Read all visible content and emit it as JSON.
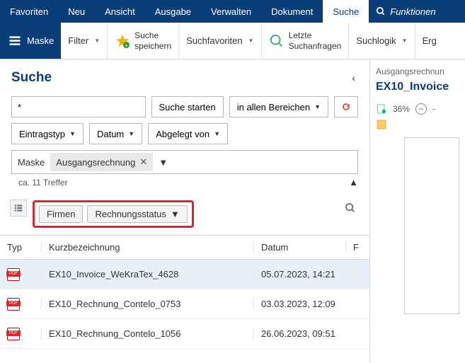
{
  "nav": {
    "items": [
      "Favoriten",
      "Neu",
      "Ansicht",
      "Ausgabe",
      "Verwalten",
      "Dokument",
      "Suche"
    ],
    "active_index": 6,
    "search_placeholder": "Funktionen"
  },
  "ribbon": {
    "maske": "Maske",
    "filter": "Filter",
    "suche_speichern_l1": "Suche",
    "suche_speichern_l2": "speichern",
    "suchfavoriten": "Suchfavoriten",
    "letzte_l1": "Letzte",
    "letzte_l2": "Suchanfragen",
    "suchlogik": "Suchlogik",
    "ergebnis": "Erg"
  },
  "search": {
    "title": "Suche",
    "query": "*",
    "start": "Suche starten",
    "scope": "in allen Bereichen",
    "eintragstyp": "Eintragstyp",
    "datum": "Datum",
    "abgelegt": "Abgelegt von",
    "maske_label": "Maske",
    "maske_chip": "Ausgangsrechnung",
    "hits": "ca. 11 Treffer",
    "firmen": "Firmen",
    "rechnungsstatus": "Rechnungsstatus"
  },
  "grid": {
    "cols": {
      "typ": "Typ",
      "kb": "Kurzbezeichnung",
      "datum": "Datum",
      "f": "F"
    },
    "rows": [
      {
        "name": "EX10_Invoice_WeKraTex_4628",
        "date": "05.07.2023, 14:21"
      },
      {
        "name": "EX10_Rechnung_Contelo_0753",
        "date": "03.03.2023, 12:09"
      },
      {
        "name": "EX10_Rechnung_Contelo_1056",
        "date": "26.06.2023, 09:51"
      }
    ]
  },
  "preview": {
    "breadcrumb": "Ausgangsrechnun",
    "title": "EX10_Invoice",
    "zoom": "36%"
  }
}
